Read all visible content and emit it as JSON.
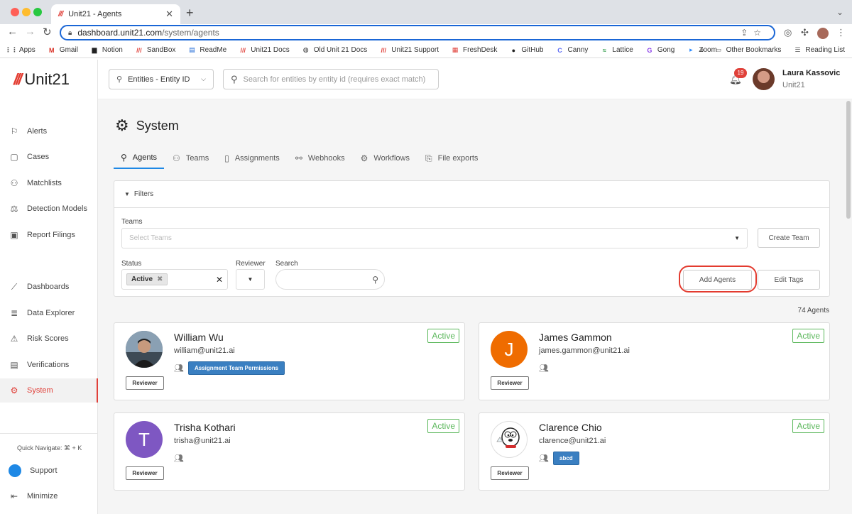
{
  "browser": {
    "tab_title": "Unit21 - Agents",
    "tab_favicon": "///",
    "close_glyph": "✕",
    "new_tab_glyph": "+",
    "menu_glyph": "⌄",
    "url_host": "dashboard.unit21.com",
    "url_path": "/system/agents",
    "bookmarks": [
      {
        "label": "Apps",
        "icon": "apps-grid-icon",
        "glyph": "⋮⋮",
        "color": "#555555"
      },
      {
        "label": "Gmail",
        "icon": "gmail-icon",
        "glyph": "M",
        "color": "#d93025"
      },
      {
        "label": "Notion",
        "icon": "notion-icon",
        "glyph": "▆",
        "color": "#222222"
      },
      {
        "label": "SandBox",
        "icon": "unit21-icon",
        "glyph": "///",
        "color": "#e0413a"
      },
      {
        "label": "ReadMe",
        "icon": "readme-icon",
        "glyph": "▤",
        "color": "#1a66d6"
      },
      {
        "label": "Unit21 Docs",
        "icon": "unit21-icon",
        "glyph": "///",
        "color": "#e0413a"
      },
      {
        "label": "Old Unit 21 Docs",
        "icon": "globe-icon",
        "glyph": "◍",
        "color": "#333333"
      },
      {
        "label": "Unit21 Support",
        "icon": "unit21-icon",
        "glyph": "///",
        "color": "#e0413a"
      },
      {
        "label": "FreshDesk",
        "icon": "freshdesk-icon",
        "glyph": "▦",
        "color": "#e0413a"
      },
      {
        "label": "GitHub",
        "icon": "github-icon",
        "glyph": "●",
        "color": "#222222"
      },
      {
        "label": "Canny",
        "icon": "canny-icon",
        "glyph": "C",
        "color": "#5c6bf5"
      },
      {
        "label": "Lattice",
        "icon": "lattice-icon",
        "glyph": "≈",
        "color": "#2e9b48"
      },
      {
        "label": "Gong",
        "icon": "gong-icon",
        "glyph": "G",
        "color": "#8a3ee8"
      },
      {
        "label": "Zoom",
        "icon": "zoom-icon",
        "glyph": "▸",
        "color": "#2d8cff"
      }
    ],
    "bookmarks_overflow": "»",
    "other_bookmarks": "Other Bookmarks",
    "reading_list": "Reading List"
  },
  "app": {
    "logo_slashes": "///",
    "logo_text": "Unit21"
  },
  "sidebar": {
    "items": [
      {
        "label": "Alerts",
        "icon": "flag-icon",
        "glyph": "⚐"
      },
      {
        "label": "Cases",
        "icon": "briefcase-icon",
        "glyph": "▢"
      },
      {
        "label": "Matchlists",
        "icon": "user-x-icon",
        "glyph": "⚇"
      },
      {
        "label": "Detection Models",
        "icon": "scale-icon",
        "glyph": "⚖"
      },
      {
        "label": "Report Filings",
        "icon": "filing-icon",
        "glyph": "▣"
      },
      {
        "label": "Dashboards",
        "icon": "chart-icon",
        "glyph": "⟋"
      },
      {
        "label": "Data Explorer",
        "icon": "data-search-icon",
        "glyph": "≣"
      },
      {
        "label": "Risk Scores",
        "icon": "warning-icon",
        "glyph": "⚠"
      },
      {
        "label": "Verifications",
        "icon": "id-card-icon",
        "glyph": "▤"
      },
      {
        "label": "System",
        "icon": "gear-icon",
        "glyph": "⚙"
      }
    ],
    "quick_navigate": "Quick Navigate: ⌘ + K",
    "support": "Support",
    "minimize": "Minimize",
    "minimize_glyph": "⇤"
  },
  "topbar": {
    "entity_select": "Entities - Entity ID",
    "entity_search_placeholder": "Search for entities by entity id (requires exact match)",
    "notification_count": "19",
    "user_name": "Laura Kassovic",
    "user_org": "Unit21"
  },
  "page": {
    "title": "System",
    "tabs": [
      {
        "label": "Agents",
        "icon": "person-icon",
        "glyph": "⚲"
      },
      {
        "label": "Teams",
        "icon": "people-icon",
        "glyph": "⚇"
      },
      {
        "label": "Assignments",
        "icon": "clipboard-icon",
        "glyph": "▯"
      },
      {
        "label": "Webhooks",
        "icon": "link-icon",
        "glyph": "⚯"
      },
      {
        "label": "Workflows",
        "icon": "cog-icon",
        "glyph": "⚙"
      },
      {
        "label": "File exports",
        "icon": "file-export-icon",
        "glyph": "⎘"
      }
    ],
    "active_tab": "Agents"
  },
  "filters": {
    "title": "Filters",
    "teams_label": "Teams",
    "teams_placeholder": "Select Teams",
    "create_team": "Create Team",
    "status_label": "Status",
    "status_chip": "Active",
    "reviewer_label": "Reviewer",
    "search_label": "Search",
    "add_agents": "Add Agents",
    "edit_tags": "Edit Tags"
  },
  "agents_count": "74 Agents",
  "agents": [
    {
      "name": "William Wu",
      "email": "william@unit21.ai",
      "status": "Active",
      "role": "Reviewer",
      "team": "Assignment Team Permissions",
      "initial": "",
      "avatar_color": "#5a6a78"
    },
    {
      "name": "James Gammon",
      "email": "james.gammon@unit21.ai",
      "status": "Active",
      "role": "Reviewer",
      "team": "",
      "initial": "J",
      "avatar_color": "#ef6c00"
    },
    {
      "name": "Trisha Kothari",
      "email": "trisha@unit21.ai",
      "status": "Active",
      "role": "Reviewer",
      "team": "",
      "initial": "T",
      "avatar_color": "#7e57c2"
    },
    {
      "name": "Clarence Chio",
      "email": "clarence@unit21.ai",
      "status": "Active",
      "role": "Reviewer",
      "team": "abcd",
      "initial": "",
      "avatar_color": "#ffffff"
    }
  ],
  "colors": {
    "brand": "#e0413a",
    "accent": "#1e88e5",
    "active_green": "#5cb85c",
    "team_badge": "#3a7fc1"
  }
}
